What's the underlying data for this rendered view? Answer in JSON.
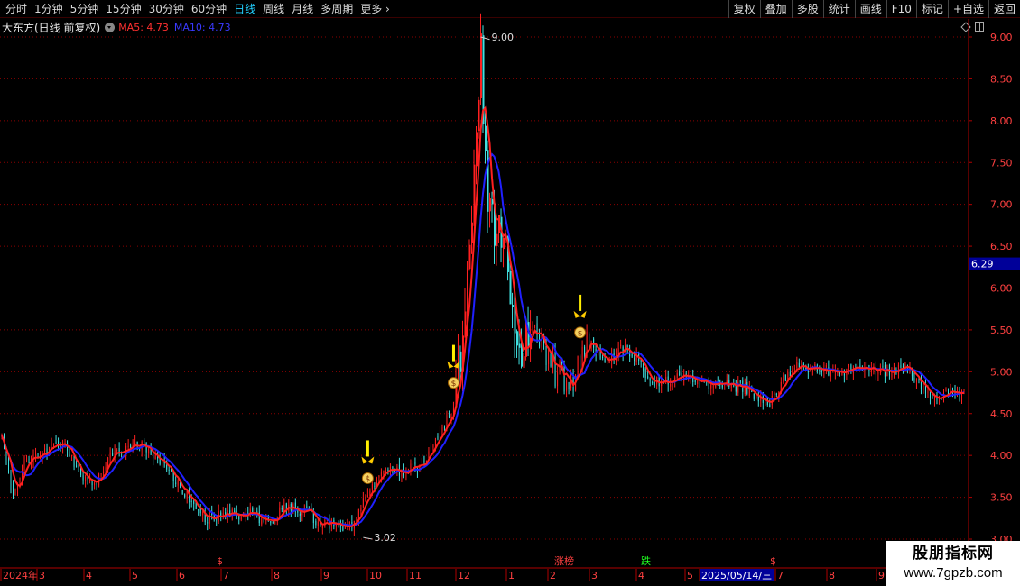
{
  "toolbar": {
    "periods": [
      "分时",
      "1分钟",
      "5分钟",
      "15分钟",
      "30分钟",
      "60分钟",
      "日线",
      "周线",
      "月线",
      "多周期",
      "更多"
    ],
    "active_period": "日线",
    "right_buttons": [
      "复权",
      "叠加",
      "多股",
      "统计",
      "画线",
      "F10",
      "标记",
      "+自选",
      "返回"
    ]
  },
  "info": {
    "title": "大东方(日线 前复权)",
    "ma5": "MA5: 4.73",
    "ma10": "MA10: 4.73"
  },
  "colors": {
    "up": "#ff2020",
    "down": "#40e0e0",
    "ma5": "#ff2020",
    "ma10": "#2020ff",
    "grid": "#8b0000",
    "axis_text": "#ff4040",
    "current_price_bg": "#000099"
  },
  "chart_data": {
    "type": "candlestick",
    "y_ticks": [
      "9.00",
      "8.50",
      "8.00",
      "7.50",
      "7.00",
      "6.50",
      "6.00",
      "5.50",
      "5.00",
      "4.50",
      "4.00",
      "3.50",
      "3.00"
    ],
    "ylim": [
      3.0,
      9.0
    ],
    "current_price": "6.29",
    "high_label": "9.00",
    "low_label": "3.02",
    "x_labels": [
      "2024年",
      "3",
      "4",
      "5",
      "6",
      "7",
      "8",
      "9",
      "10",
      "11",
      "12",
      "1",
      "2",
      "3",
      "4",
      "5",
      "2025/05/14/三",
      "7",
      "8",
      "9"
    ],
    "markers": [
      {
        "text": "$",
        "color": "#ff4040"
      },
      {
        "text": "涨榜",
        "color": "#ff4040"
      },
      {
        "text": "跌",
        "color": "#20ff20"
      },
      {
        "text": "$",
        "color": "#ff4040"
      }
    ],
    "ma_close_anchors": [
      [
        0,
        4.2
      ],
      [
        5,
        3.55
      ],
      [
        10,
        3.95
      ],
      [
        20,
        4.05
      ],
      [
        28,
        4.15
      ],
      [
        35,
        3.75
      ],
      [
        42,
        3.7
      ],
      [
        48,
        4.0
      ],
      [
        60,
        4.15
      ],
      [
        70,
        3.95
      ],
      [
        80,
        3.6
      ],
      [
        90,
        3.25
      ],
      [
        100,
        3.28
      ],
      [
        110,
        3.3
      ],
      [
        118,
        3.2
      ],
      [
        125,
        3.38
      ],
      [
        135,
        3.32
      ],
      [
        140,
        3.2
      ],
      [
        150,
        3.15
      ],
      [
        156,
        3.2
      ],
      [
        162,
        3.55
      ],
      [
        168,
        3.8
      ],
      [
        178,
        3.8
      ],
      [
        186,
        3.9
      ],
      [
        194,
        4.3
      ],
      [
        200,
        4.6
      ],
      [
        204,
        5.4
      ],
      [
        208,
        6.6
      ],
      [
        210,
        8.0
      ],
      [
        212,
        8.8
      ],
      [
        215,
        7.0
      ],
      [
        218,
        6.7
      ],
      [
        222,
        6.6
      ],
      [
        226,
        5.8
      ],
      [
        230,
        5.3
      ],
      [
        236,
        5.5
      ],
      [
        240,
        5.2
      ],
      [
        246,
        5.0
      ],
      [
        252,
        4.85
      ],
      [
        258,
        5.35
      ],
      [
        262,
        5.3
      ],
      [
        268,
        5.1
      ],
      [
        274,
        5.3
      ],
      [
        280,
        5.2
      ],
      [
        286,
        4.95
      ],
      [
        292,
        4.85
      ],
      [
        300,
        4.95
      ],
      [
        310,
        4.85
      ],
      [
        320,
        4.85
      ],
      [
        330,
        4.8
      ],
      [
        340,
        4.6
      ],
      [
        346,
        4.9
      ],
      [
        352,
        5.05
      ],
      [
        360,
        5.05
      ],
      [
        370,
        5.0
      ],
      [
        380,
        5.05
      ],
      [
        390,
        5.0
      ],
      [
        400,
        5.05
      ],
      [
        406,
        4.85
      ],
      [
        412,
        4.72
      ],
      [
        420,
        4.75
      ],
      [
        426,
        4.73
      ]
    ]
  },
  "watermark": {
    "title": "股朋指标网",
    "url": "www.7gpzb.com"
  }
}
